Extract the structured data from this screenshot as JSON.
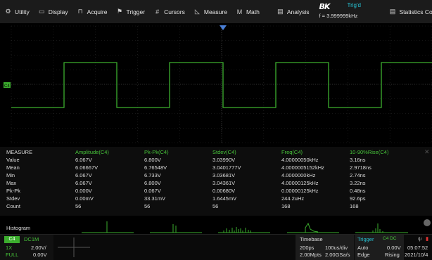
{
  "menu": [
    {
      "icon": "⚙",
      "icon_name": "gear-icon",
      "label": "Utility"
    },
    {
      "icon": "▭",
      "icon_name": "display-icon",
      "label": "Display"
    },
    {
      "icon": "⊓",
      "icon_name": "acquire-icon",
      "label": "Acquire"
    },
    {
      "icon": "⚑",
      "icon_name": "flag-icon",
      "label": "Trigger"
    },
    {
      "icon": "#",
      "icon_name": "cursors-icon",
      "label": "Cursors"
    },
    {
      "icon": "◺",
      "icon_name": "measure-icon",
      "label": "Measure"
    },
    {
      "icon": "M",
      "icon_name": "math-icon",
      "label": "Math"
    },
    {
      "icon": "▤",
      "icon_name": "analysis-icon",
      "label": "Analysis"
    }
  ],
  "status": {
    "logo": "BK",
    "trig_state": "Trig'd",
    "frequency": "f = 3.999999kHz",
    "stats_label": "Statistics Config"
  },
  "waveform": {
    "color": "#3cae2e",
    "channel_marker": "C4"
  },
  "measure": {
    "title": "MEASURE",
    "headers": [
      "Amplitude(C4)",
      "Pk-Pk(C4)",
      "Stdev(C4)",
      "Freq(C4)",
      "10-90%Rise(C4)"
    ],
    "rows": [
      {
        "label": "Value",
        "values": [
          "6.067V",
          "6.800V",
          "3.03990V",
          "4.00000050kHz",
          "3.16ns"
        ]
      },
      {
        "label": "Mean",
        "values": [
          "6.06667V",
          "6.76548V",
          "3.0401777V",
          "4.0000005152kHz",
          "2.9718ns"
        ]
      },
      {
        "label": "Min",
        "values": [
          "6.067V",
          "6.733V",
          "3.03681V",
          "4.0000000kHz",
          "2.74ns"
        ]
      },
      {
        "label": "Max",
        "values": [
          "6.067V",
          "6.800V",
          "3.04361V",
          "4.00000125kHz",
          "3.22ns"
        ]
      },
      {
        "label": "Pk-Pk",
        "values": [
          "0.000V",
          "0.067V",
          "0.00680V",
          "0.00000125kHz",
          "0.48ns"
        ]
      },
      {
        "label": "Stdev",
        "values": [
          "0.00mV",
          "33.31mV",
          "1.6445mV",
          "244.2uHz",
          "92.6ps"
        ]
      },
      {
        "label": "Count",
        "values": [
          "56",
          "56",
          "56",
          "168",
          "168"
        ]
      }
    ],
    "histogram_label": "Histogram"
  },
  "channel": {
    "name": "C4",
    "coupling": "DC1M",
    "probe": "1X",
    "vdiv": "2.00V/",
    "bw": "FULL",
    "offset": "0.00V"
  },
  "timebase": {
    "title": "Timebase",
    "delay": "200ps",
    "tdiv": "100us/div",
    "mpts": "2.00Mpts",
    "srate": "2.00GSa/s"
  },
  "trigger": {
    "title": "Trigger",
    "source": "C4 DC",
    "mode": "Auto",
    "level": "0.00V",
    "type": "Edge",
    "slope": "Rising"
  },
  "clock": {
    "time": "05:07:52",
    "date": "2021/10/4"
  }
}
